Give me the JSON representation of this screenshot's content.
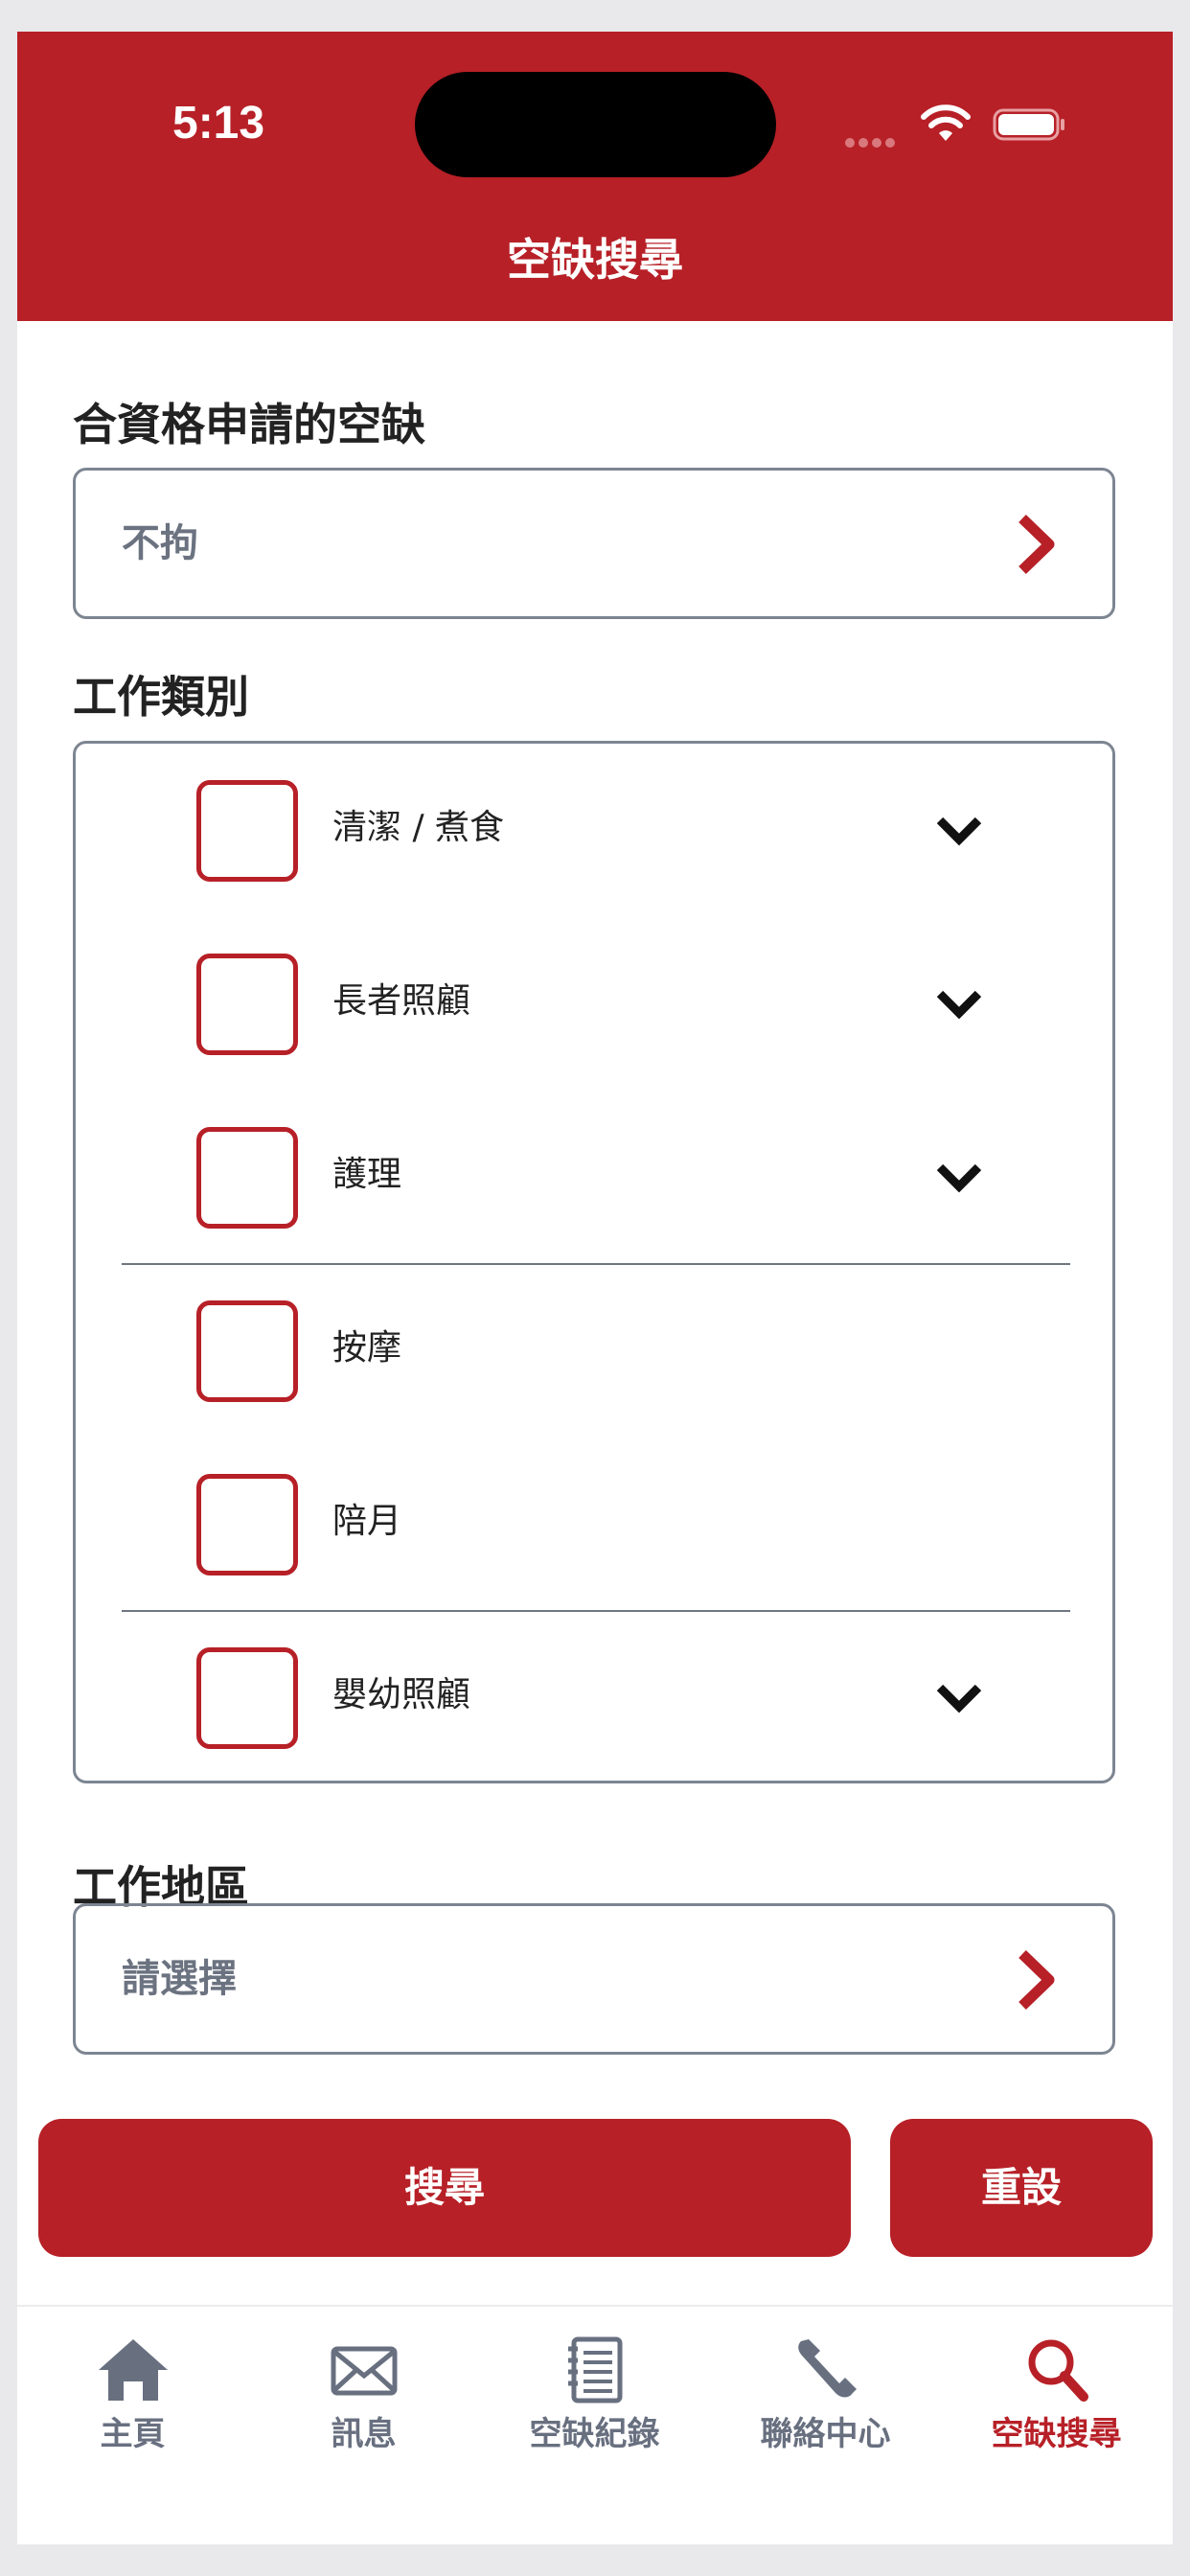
{
  "status_bar": {
    "time": "5:13"
  },
  "header": {
    "title": "空缺搜尋"
  },
  "eligible": {
    "label": "合資格申請的空缺",
    "value": "不拘"
  },
  "categories": {
    "label": "工作類別",
    "items": [
      {
        "label": "清潔 / 煮食"
      },
      {
        "label": "長者照顧"
      },
      {
        "label": "護理"
      },
      {
        "label": "按摩"
      },
      {
        "label": "陪月"
      },
      {
        "label": "嬰幼照顧"
      }
    ]
  },
  "region": {
    "label": "工作地區",
    "value": "請選擇"
  },
  "buttons": {
    "search": "搜尋",
    "reset": "重設"
  },
  "tabs": [
    {
      "label": "主頁",
      "icon": "home-icon"
    },
    {
      "label": "訊息",
      "icon": "envelope-icon"
    },
    {
      "label": "空缺紀錄",
      "icon": "notebook-icon"
    },
    {
      "label": "聯絡中心",
      "icon": "phone-icon"
    },
    {
      "label": "空缺搜尋",
      "icon": "search-icon",
      "active": true
    }
  ],
  "colors": {
    "brand": "#b72027",
    "muted": "#687080",
    "border": "#7d8592"
  }
}
